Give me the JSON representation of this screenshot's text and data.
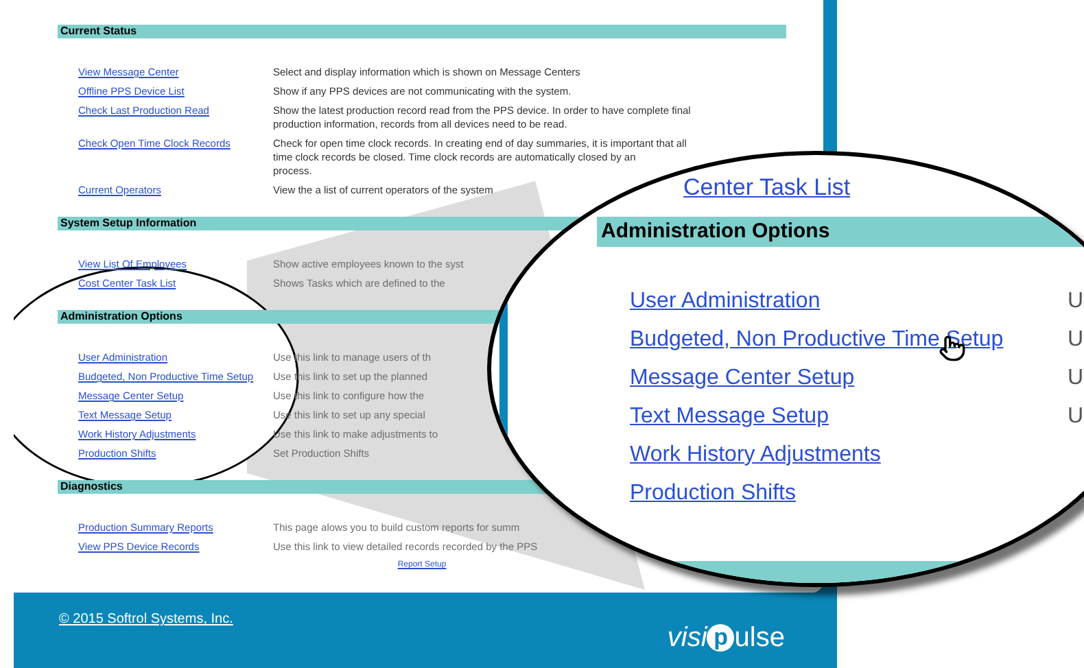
{
  "sections": [
    {
      "title": "Current Status",
      "rows": [
        {
          "link": "View Message Center",
          "dimmed": false,
          "lines": [
            "Select and display information which is shown on Message Centers"
          ]
        },
        {
          "link": "Offline PPS Device List",
          "dimmed": false,
          "lines": [
            "Show if any PPS devices are not communicating with the system."
          ]
        },
        {
          "link": "Check Last Production Read",
          "dimmed": false,
          "lines": [
            "Show the latest production record read from the PPS device. In order to have complete final",
            "production information, records from all devices need to be read."
          ]
        },
        {
          "link": "Check Open Time Clock Records",
          "dimmed": false,
          "lines": [
            "Check for open time clock records. In creating end of day summaries, it is important that all",
            "time clock records be closed. Time clock records are automatically closed by an",
            "process."
          ]
        },
        {
          "link": "Current Operators",
          "dimmed": false,
          "lines": [
            "View the a list of current operators of the system"
          ]
        }
      ]
    },
    {
      "title": "System Setup Information",
      "rows": [
        {
          "link": "View List Of Employees",
          "dimmed": true,
          "lines": [
            "Show active employees known to the syst"
          ]
        },
        {
          "link": "Cost Center Task List",
          "dimmed": true,
          "lines": [
            "Shows Tasks which are defined to the"
          ]
        }
      ]
    },
    {
      "title": "Administration Options",
      "rows": [
        {
          "link": "User Administration",
          "dimmed": true,
          "lines": [
            "Use this link to manage users of th"
          ]
        },
        {
          "link": "Budgeted, Non Productive Time Setup",
          "dimmed": true,
          "lines": [
            "Use this link to set up the planned"
          ]
        },
        {
          "link": "Message Center Setup",
          "dimmed": true,
          "lines": [
            "Use this link to configure how the"
          ]
        },
        {
          "link": "Text Message Setup",
          "dimmed": true,
          "lines": [
            "Use this link to set up any special"
          ]
        },
        {
          "link": "Work History Adjustments",
          "dimmed": true,
          "lines": [
            "Use this link to make adjustments to"
          ]
        },
        {
          "link": "Production Shifts",
          "dimmed": true,
          "lines": [
            "Set Production Shifts"
          ]
        }
      ]
    },
    {
      "title": "Diagnostics",
      "rows": [
        {
          "link": "Production Summary Reports",
          "dimmed": true,
          "lines": [
            "This page alows you to build custom reports for summ"
          ]
        },
        {
          "link": "View PPS Device Records",
          "dimmed": true,
          "lines": [
            "Use this link to view detailed records recorded by the PPS"
          ]
        }
      ]
    }
  ],
  "report_link": "Report Setup",
  "magnifier": {
    "partial_link": "Center Task List",
    "section_title": "Administration Options",
    "links": [
      {
        "label": "User Administration",
        "column_2": "U",
        "pointer": false
      },
      {
        "label": "Budgeted, Non Productive Time Setup",
        "column_2": "U",
        "pointer": true
      },
      {
        "label": "Message Center Setup",
        "column_2": "U",
        "pointer": false
      },
      {
        "label": "Text Message Setup",
        "column_2": "U",
        "pointer": false
      },
      {
        "label": "Work History Adjustments",
        "pointer": false
      },
      {
        "label": "Production Shifts",
        "pointer": false
      }
    ]
  },
  "footer": {
    "copyright": "© 2015 Softrol Systems, Inc.",
    "logo": {
      "prefix": "visi",
      "mark": "p",
      "suffix": "ulse"
    }
  }
}
